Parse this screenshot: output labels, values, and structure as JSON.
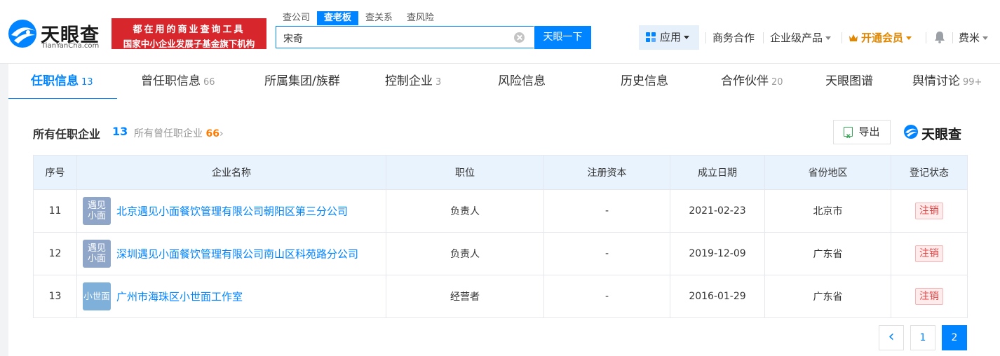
{
  "brand": {
    "name_cn": "天眼查",
    "name_en": "TianYanCha.com",
    "brand_color": "#0084ff"
  },
  "banner": {
    "line1": "都在用的商业查询工具",
    "line2": "国家中小企业发展子基金旗下机构"
  },
  "search": {
    "tabs": [
      "查公司",
      "查老板",
      "查关系",
      "查风险"
    ],
    "active_tab": 1,
    "value": "宋奇",
    "button_label": "天眼一下"
  },
  "nav": {
    "app": "应用",
    "business": "商务合作",
    "enterprise": "企业级产品",
    "vip": "开通会员",
    "user": "费米"
  },
  "tabs": [
    {
      "label": "任职信息",
      "count": "13"
    },
    {
      "label": "曾任职信息",
      "count": "66"
    },
    {
      "label": "所属集团/族群",
      "count": ""
    },
    {
      "label": "控制企业",
      "count": "3"
    },
    {
      "label": "风险信息",
      "count": ""
    },
    {
      "label": "历史信息",
      "count": ""
    },
    {
      "label": "合作伙伴",
      "count": "20"
    },
    {
      "label": "天眼图谱",
      "count": ""
    },
    {
      "label": "舆情讨论",
      "count": "99+"
    }
  ],
  "section": {
    "title": "所有任职企业",
    "count": "13",
    "link_prefix": "所有曾任职企业",
    "link_count": "66",
    "link_arrow": "›",
    "export_label": "导出",
    "watermark": "天眼查"
  },
  "table": {
    "headers": [
      "序号",
      "企业名称",
      "职位",
      "注册资本",
      "成立日期",
      "省份地区",
      "登记状态"
    ],
    "rows": [
      {
        "no": "11",
        "logo_text_1": "遇见",
        "logo_text_2": "小面",
        "logo_color": "#8fa6c9",
        "name": "北京遇见小面餐饮管理有限公司朝阳区第三分公司",
        "position": "负责人",
        "capital": "-",
        "date": "2021-02-23",
        "region": "北京市",
        "status": "注销"
      },
      {
        "no": "12",
        "logo_text_1": "遇见",
        "logo_text_2": "小面",
        "logo_color": "#8fa6c9",
        "name": "深圳遇见小面餐饮管理有限公司南山区科苑路分公司",
        "position": "负责人",
        "capital": "-",
        "date": "2019-12-09",
        "region": "广东省",
        "status": "注销"
      },
      {
        "no": "13",
        "logo_text_1": "小世面",
        "logo_text_2": "",
        "logo_color": "#7fb0d9",
        "name": "广州市海珠区小世面工作室",
        "position": "经营者",
        "capital": "-",
        "date": "2016-01-29",
        "region": "广东省",
        "status": "注销"
      }
    ]
  },
  "pagination": {
    "prev": "‹",
    "pages": [
      "1",
      "2"
    ],
    "current": "2"
  }
}
